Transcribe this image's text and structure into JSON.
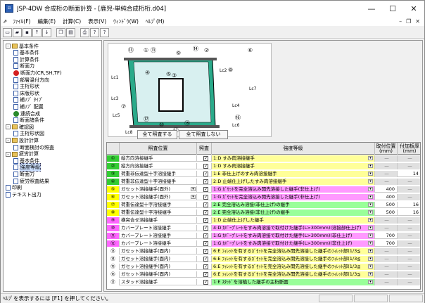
{
  "window": {
    "title": "JSP-4DW 合成桁の断面計算 - [鹿児-単純合成桁桁.d04]"
  },
  "menu": [
    {
      "label": "ﾌｧｲﾙ(F)"
    },
    {
      "label": "編集(E)"
    },
    {
      "label": "計算(C)"
    },
    {
      "label": "表示(V)"
    },
    {
      "label": "ｳｨﾝﾄﾞｳ(W)"
    },
    {
      "label": "ﾍﾙﾌﾟ(H)"
    }
  ],
  "toolbar": {
    "icons": [
      "new-icon",
      "open-icon",
      "save-icon",
      "arrow-up-icon",
      "arrow-down-icon",
      "copy-icon",
      "paste-icon",
      "print-icon",
      "help-icon",
      "context-help-icon"
    ]
  },
  "tree": [
    {
      "label": "基本条件",
      "level": 0,
      "type": "folder",
      "exp": "-"
    },
    {
      "label": "基本条件",
      "level": 1,
      "type": "doc"
    },
    {
      "label": "計算条件",
      "level": 1,
      "type": "doc"
    },
    {
      "label": "断面力",
      "level": 1,
      "type": "doc"
    },
    {
      "label": "断面力(CR,SH,TF)",
      "level": 1,
      "type": "red"
    },
    {
      "label": "部層温付方向",
      "level": 1,
      "type": "doc"
    },
    {
      "label": "主桁形状",
      "level": 1,
      "type": "doc"
    },
    {
      "label": "床版形状",
      "level": 1,
      "type": "doc"
    },
    {
      "label": "補ｿﾌﾞ ﾀｲﾌﾟ",
      "level": 1,
      "type": "doc"
    },
    {
      "label": "補ｿﾌﾞ 配置",
      "level": 1,
      "type": "doc"
    },
    {
      "label": "連続合成",
      "level": 1,
      "type": "green"
    },
    {
      "label": "断面諸条件",
      "level": 1,
      "type": "doc"
    },
    {
      "label": "確認図",
      "level": 0,
      "type": "folder",
      "exp": "-"
    },
    {
      "label": "主桁形状図",
      "level": 1,
      "type": "doc"
    },
    {
      "label": "設計計算",
      "level": 0,
      "type": "folder",
      "exp": "-"
    },
    {
      "label": "断面検討の照査",
      "level": 1,
      "type": "doc"
    },
    {
      "label": "疲労計算",
      "level": 0,
      "type": "folder",
      "exp": "-"
    },
    {
      "label": "基本条件",
      "level": 1,
      "type": "doc"
    },
    {
      "label": "強度等級",
      "level": 1,
      "type": "doc",
      "selected": true
    },
    {
      "label": "断面力",
      "level": 1,
      "type": "doc"
    },
    {
      "label": "疲労照査結果",
      "level": 1,
      "type": "doc"
    },
    {
      "label": "印刷",
      "level": 0,
      "type": "doc"
    },
    {
      "label": "テキスト出力",
      "level": 0,
      "type": "doc"
    }
  ],
  "buttons": {
    "check_all": "全て照査する",
    "check_none": "全て照査しない"
  },
  "grid": {
    "headers": {
      "position": "照査位置",
      "check": "照査",
      "grade": "強度等級",
      "pos": "取付位置 (mm)",
      "thick": "付加板厚 (mm)"
    },
    "rows": [
      {
        "n": "①",
        "color": "#33cc33",
        "position": "縦方向溶接継手",
        "grade": "1:D すみ肉溶接継手",
        "pos": "—",
        "thick": "—",
        "rowbg": "#ffffff",
        "gbg": "#ffff99"
      },
      {
        "n": "②",
        "color": "#33cc33",
        "position": "縦方向溶接継手",
        "grade": "1:D すみ肉溶接継手",
        "pos": "—",
        "thick": "—",
        "rowbg": "#ffffff",
        "gbg": "#ffff99"
      },
      {
        "n": "③",
        "color": "#33cc33",
        "position": "荷重非伝達型十字溶接継手",
        "grade": "1:E 非仕上げのすみ肉溶接継手",
        "pos": "—",
        "thick": "14",
        "rowbg": "#ffffff",
        "gbg": "#ffff99"
      },
      {
        "n": "④",
        "color": "#33cc33",
        "position": "荷重非伝達型十字溶接継手",
        "grade": "2:D 止端仕上げしたすみ肉溶接継手",
        "pos": "—",
        "thick": "—",
        "rowbg": "#ffffff",
        "gbg": "#ffff99"
      },
      {
        "n": "⑤",
        "color": "#ffff00",
        "position": "ガセット溶接継手(面外)",
        "grade": "1:G ｶﾞｾｯﾄを完全溶込み開先溶接した継手(非仕上げ)",
        "pos": "400",
        "thick": "—",
        "rowbg": "#ffffff",
        "gbg": "#ff99ff",
        "dd": true
      },
      {
        "n": "⑥",
        "color": "#ffff00",
        "position": "ガセット溶接継手(面外)",
        "grade": "1:G ｶﾞｾｯﾄを完全溶込み開先溶接した継手(非仕上げ)",
        "pos": "400",
        "thick": "—",
        "rowbg": "#ffffff",
        "gbg": "#ff99ff",
        "dd": true
      },
      {
        "n": "⑦",
        "color": "#ffff00",
        "position": "荷重伝達型十字溶接継手",
        "grade": "2:E 完全溶込み溶接(非仕上げ)の継手",
        "pos": "500",
        "thick": "16",
        "rowbg": "#ffffff",
        "gbg": "#99ff99"
      },
      {
        "n": "⑧",
        "color": "#ffff00",
        "position": "荷重伝達型十字溶接継手",
        "grade": "2:E 完全溶込み溶接(非仕上げ)の継手",
        "pos": "500",
        "thick": "16",
        "rowbg": "#ffffff",
        "gbg": "#99ff99"
      },
      {
        "n": "⑨",
        "color": "#ff66ff",
        "position": "横突合せ溶接継手",
        "grade": "1:D 止端仕上げした継手",
        "pos": "—",
        "thick": "—",
        "rowbg": "#ffffff",
        "gbg": "#ffff99"
      },
      {
        "n": "⑩",
        "color": "#ff66ff",
        "position": "カバープレート溶接継手",
        "grade": "4:D ｶﾊﾞｰﾌﾟﾚｰﾄをすみ肉溶接で取付けた継手(L>300mm)(溶接部仕上げ)",
        "pos": "—",
        "thick": "—",
        "rowbg": "#ffffff",
        "gbg": "#ff99ff"
      },
      {
        "n": "⑪",
        "color": "#ff66ff",
        "position": "カバープレート溶接継手",
        "grade": "1:G ｶﾊﾞｰﾌﾟﾚｰﾄをすみ肉溶接で取付けた継手(L>300mm)(非仕上げ)",
        "pos": "700",
        "thick": "—",
        "rowbg": "#ffffff",
        "gbg": "#ff99ff"
      },
      {
        "n": "⑫",
        "color": "#ff66ff",
        "position": "カバープレート溶接継手",
        "grade": "1:G ｶﾊﾞｰﾌﾟﾚｰﾄをすみ肉溶接で取付けた継手(L>300mm)(非仕上げ)",
        "pos": "700",
        "thick": "—",
        "rowbg": "#ffffff",
        "gbg": "#ff99ff"
      },
      {
        "n": "⑬",
        "color": "#ffffff",
        "position": "ガセット溶接継手(面内)",
        "grade": "6:E ﾌｨﾚｯﾄを有するｶﾞｾｯﾄを完全溶込み開先溶接した継手のﾌｨﾚｯﾄ部(1/3≦",
        "pos": "—",
        "thick": "—",
        "rowbg": "#ffffff",
        "gbg": "#ffff99"
      },
      {
        "n": "⑭",
        "color": "#ffffff",
        "position": "ガセット溶接継手(面内)",
        "grade": "6:E ﾌｨﾚｯﾄを有するｶﾞｾｯﾄを完全溶込み開先溶接した継手のﾌｨﾚｯﾄ部(1/3≦",
        "pos": "—",
        "thick": "—",
        "rowbg": "#ffffff",
        "gbg": "#ffff99"
      },
      {
        "n": "⑮",
        "color": "#ffffff",
        "position": "ガセット溶接継手(面内)",
        "grade": "6:E ﾌｨﾚｯﾄを有するｶﾞｾｯﾄを完全溶込み開先溶接した継手のﾌｨﾚｯﾄ部(1/3≦",
        "pos": "—",
        "thick": "—",
        "rowbg": "#ffffff",
        "gbg": "#ffff99"
      },
      {
        "n": "⑯",
        "color": "#ffffff",
        "position": "ガセット溶接継手(面内)",
        "grade": "6:E ﾌｨﾚｯﾄを有するｶﾞｾｯﾄを完全溶込み開先溶接した継手のﾌｨﾚｯﾄ部(1/3≦",
        "pos": "—",
        "thick": "—",
        "rowbg": "#ffffff",
        "gbg": "#ffff99"
      },
      {
        "n": "⑰",
        "color": "#ffffff",
        "position": "スタッド溶接継手",
        "grade": "1:E ｽﾀｯﾄﾞを溶植した継手の主桁断面",
        "pos": "—",
        "thick": "—",
        "rowbg": "#ffffff",
        "gbg": "#99ff99"
      }
    ]
  },
  "diagram": {
    "labels": [
      "①",
      "②",
      "③",
      "④",
      "⑤",
      "⑥",
      "⑦",
      "⑧",
      "⑨",
      "⑩",
      "⑪",
      "⑫",
      "⑬",
      "⑭",
      "⑮",
      "⑯",
      "⑰"
    ],
    "dims": [
      "Lc1",
      "Lc2",
      "Lc3",
      "Lc4",
      "Lc5",
      "Lc6",
      "Lc7",
      "Lc8"
    ]
  },
  "status": {
    "text": "ﾍﾙﾌﾟを表示するには [F1] を押してください。"
  }
}
